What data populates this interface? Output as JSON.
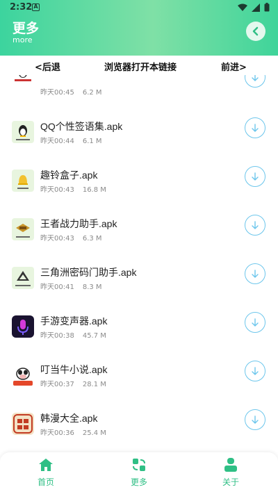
{
  "status": {
    "time": "2:32",
    "notif_letter": "A"
  },
  "header": {
    "title": "更多",
    "subtitle": "more"
  },
  "browser": {
    "back_label": "<后退",
    "open_label": "浏览器打开本链接",
    "forward_label": "前进>"
  },
  "files": [
    {
      "name": "",
      "date": "昨天00:45",
      "size": "6.2 M",
      "icon": "panda-app-icon",
      "icon_bg": "#ffffff"
    },
    {
      "name": "QQ个性签语集.apk",
      "date": "昨天00:44",
      "size": "6.1 M",
      "icon": "qq-penguin-icon",
      "icon_bg": "#e8f5df"
    },
    {
      "name": "趣铃盒子.apk",
      "date": "昨天00:43",
      "size": "16.8 M",
      "icon": "bell-app-icon",
      "icon_bg": "#e8f5df"
    },
    {
      "name": "王者战力助手.apk",
      "date": "昨天00:43",
      "size": "6.3 M",
      "icon": "game-logo-icon",
      "icon_bg": "#e8f5df"
    },
    {
      "name": "三角洲密码门助手.apk",
      "date": "昨天00:41",
      "size": "8.3 M",
      "icon": "triangle-logo-icon",
      "icon_bg": "#e8f5df"
    },
    {
      "name": "手游变声器.apk",
      "date": "昨天00:38",
      "size": "45.7 M",
      "icon": "microphone-app-icon",
      "icon_bg": "#1a1330"
    },
    {
      "name": "叮当牛小说.apk",
      "date": "昨天00:37",
      "size": "28.1 M",
      "icon": "cow-app-icon",
      "icon_bg": "#ffffff"
    },
    {
      "name": "韩漫大全.apk",
      "date": "昨天00:36",
      "size": "25.4 M",
      "icon": "manhua-app-icon",
      "icon_bg": "#f4e2c6"
    }
  ],
  "tabs": [
    {
      "label": "首页",
      "icon": "home-icon"
    },
    {
      "label": "更多",
      "icon": "swap-icon"
    },
    {
      "label": "关于",
      "icon": "person-icon"
    }
  ],
  "colors": {
    "accent": "#2fbf85",
    "header_start": "#3cd49e",
    "download_ring": "#6cc6ec"
  }
}
